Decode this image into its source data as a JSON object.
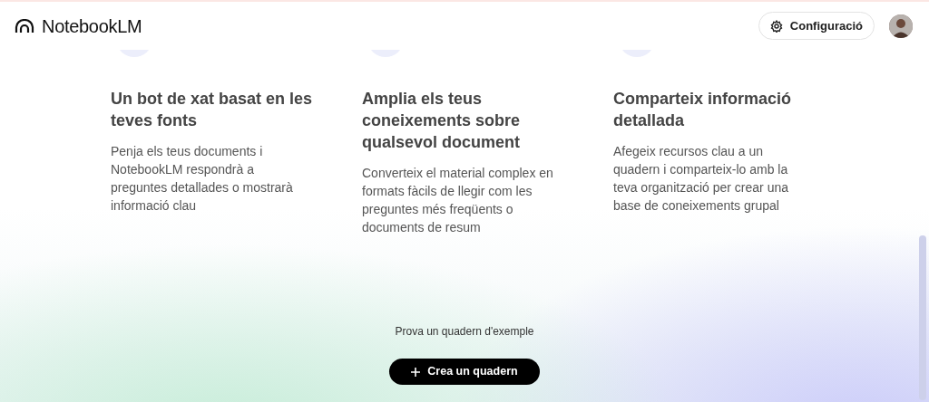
{
  "header": {
    "logo": "NotebookLM",
    "settings_button": "Configuració"
  },
  "features": [
    {
      "title": "Un bot de xat basat en les teves fonts",
      "description": "Penja els teus documents i NotebookLM respondrà a preguntes detallades o mostrarà informació clau"
    },
    {
      "title": "Amplia els teus coneixements sobre qualsevol document",
      "description": "Converteix el material complex en formats fàcils de llegir com les preguntes més freqüents o documents de resum"
    },
    {
      "title": "Comparteix informació detallada",
      "description": "Afegeix recursos clau a un quadern i comparteix-lo amb la teva organització per crear una base de coneixements grupal"
    }
  ],
  "example_link": "Prova un quadern d'exemple",
  "create_button": "Crea un quadern"
}
